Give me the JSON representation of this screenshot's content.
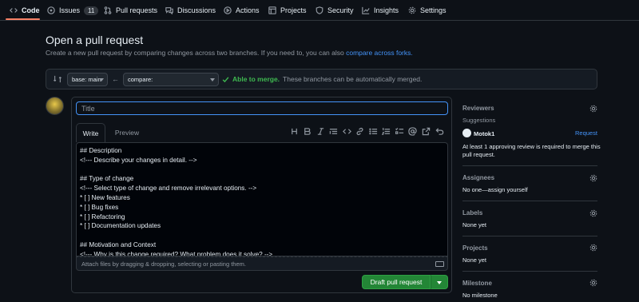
{
  "nav": {
    "items": [
      {
        "label": "Code",
        "icon": "code-icon"
      },
      {
        "label": "Issues",
        "icon": "issue-icon",
        "count": "11"
      },
      {
        "label": "Pull requests",
        "icon": "pull-request-icon"
      },
      {
        "label": "Discussions",
        "icon": "discussion-icon"
      },
      {
        "label": "Actions",
        "icon": "play-icon"
      },
      {
        "label": "Projects",
        "icon": "table-icon"
      },
      {
        "label": "Security",
        "icon": "shield-icon"
      },
      {
        "label": "Insights",
        "icon": "graph-icon"
      },
      {
        "label": "Settings",
        "icon": "gear-icon"
      }
    ]
  },
  "header": {
    "title": "Open a pull request",
    "subtitle": "Create a new pull request by comparing changes across two branches. If you need to, you can also",
    "subtitle_link": "compare across forks."
  },
  "compare": {
    "base_label": "base: main",
    "compare_label": "compare:",
    "merge_status": "Able to merge.",
    "merge_message": "These branches can be automatically merged."
  },
  "editor": {
    "title_placeholder": "Title",
    "tab_write": "Write",
    "tab_preview": "Preview",
    "toolbar": [
      "heading-icon",
      "bold-icon",
      "italic-icon",
      "quote-icon",
      "code-icon",
      "link-icon",
      "unordered-list-icon",
      "ordered-list-icon",
      "task-list-icon",
      "mention-icon",
      "reference-icon",
      "undo-icon"
    ],
    "body_lines": [
      "## Description",
      "<!--- Describe your changes in detail. -->",
      "",
      "## Type of change",
      "<!--- Select type of change and remove irrelevant options. -->",
      "* [ ] New features",
      "* [ ] Bug fixes",
      "* [ ] Refactoring",
      "* [ ] Documentation updates",
      "",
      "## Motivation and Context",
      "<!--- Why is this change required? What problem does it solve? -->"
    ],
    "attach_text": "Attach files by dragging & dropping, selecting or pasting them.",
    "submit_label": "Draft pull request"
  },
  "sidebar": {
    "reviewers_title": "Reviewers",
    "suggestions_label": "Suggestions",
    "suggested_user": "Motok1",
    "request_label": "Request",
    "review_note": "At least 1 approving review is required to merge this",
    "review_note_2": "pull request.",
    "assignees_title": "Assignees",
    "assignees_value": "No one—assign yourself",
    "labels_title": "Labels",
    "labels_value": "None yet",
    "projects_title": "Projects",
    "projects_value": "None yet",
    "milestone_title": "Milestone",
    "milestone_value": "No milestone"
  },
  "colors": {
    "accent": "#4493f8",
    "success": "#3fb950",
    "button_green": "#238636",
    "tab_underline": "#f78166"
  }
}
